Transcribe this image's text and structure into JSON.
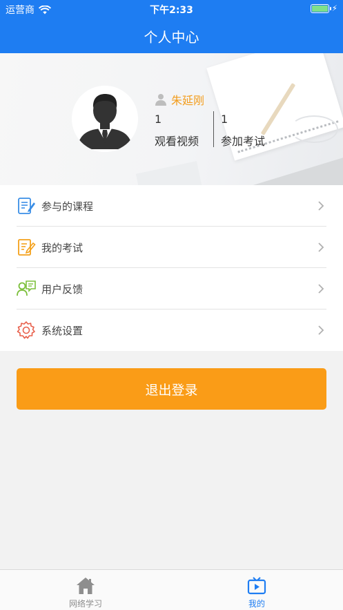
{
  "status_bar": {
    "carrier": "运营商",
    "time": "下午2:33"
  },
  "nav": {
    "title": "个人中心"
  },
  "profile": {
    "username": "朱延刚",
    "stats": [
      {
        "value": "1",
        "label": "观看视频"
      },
      {
        "value": "1",
        "label": "参加考试"
      }
    ]
  },
  "menu": {
    "items": [
      {
        "label": "参与的课程",
        "icon": "course-doc-icon"
      },
      {
        "label": "我的考试",
        "icon": "exam-edit-icon"
      },
      {
        "label": "用户反馈",
        "icon": "feedback-user-icon"
      },
      {
        "label": "系统设置",
        "icon": "settings-gear-icon"
      }
    ]
  },
  "logout": {
    "label": "退出登录"
  },
  "tabbar": {
    "tabs": [
      {
        "label": "网络学习",
        "icon": "home-icon",
        "active": false
      },
      {
        "label": "我的",
        "icon": "tv-icon",
        "active": true
      }
    ]
  },
  "colors": {
    "primary": "#1e7df2",
    "accent": "#fa9c17",
    "username": "#f39c1a",
    "icon_blue": "#3a8ee6",
    "icon_orange": "#f4a11b",
    "icon_green": "#7bbf3a",
    "icon_red": "#e8604c"
  }
}
